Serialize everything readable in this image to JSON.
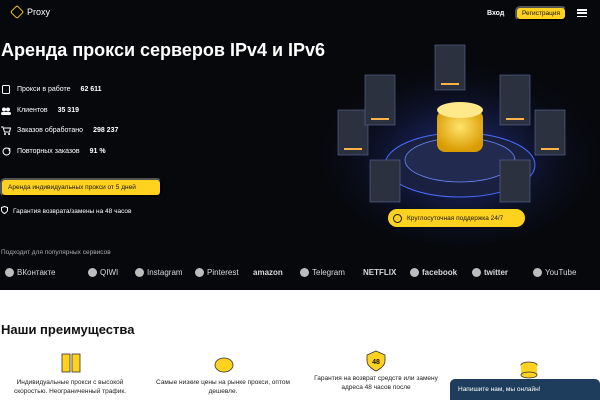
{
  "header": {
    "brand": "Proxy",
    "login": "Вход",
    "register": "Регистрация"
  },
  "hero": {
    "title": "Аренда прокси серверов IPv4 и IPv6",
    "stats": [
      {
        "label": "Прокси в работе",
        "value": "62 611",
        "icon": "server-icon"
      },
      {
        "label": "Клиентов",
        "value": "35 319",
        "icon": "users-icon"
      },
      {
        "label": "Заказов обработано",
        "value": "298 237",
        "icon": "cart-icon"
      },
      {
        "label": "Повторных заказов",
        "value": "91 %",
        "icon": "repeat-icon"
      }
    ],
    "cta": "Аренда индивидуальных прокси от 5 дней",
    "guarantee": "Гарантия возврата/замены на 48 часов",
    "support": "Круглосуточная поддержка 24/7",
    "popular": "Подходит для популярных сервисов"
  },
  "brands": [
    "ВКонтакте",
    "QIWI",
    "Instagram",
    "Pinterest",
    "amazon",
    "Telegram",
    "NETFLIX",
    "facebook",
    "twitter",
    "YouTube"
  ],
  "advantages": {
    "title": "Наши преимущества",
    "items": [
      {
        "text": "Индивидуальные прокси с высокой скоростью. Неограниченный трафик.",
        "icon": "server-rack-icon"
      },
      {
        "text": "Самые низкие цены на рынке прокси, оптом дешевле.",
        "icon": "piggy-bank-icon"
      },
      {
        "text": "Гарантия на возврат средств или замену адреса 48 часов после",
        "icon": "shield-48-icon",
        "badge": "48"
      },
      {
        "text": "",
        "icon": "database-icon"
      }
    ]
  },
  "chat": {
    "label": "Напишите нам, мы онлайн!"
  },
  "colors": {
    "accent": "#ffd21f",
    "hero_bg": "#07080c",
    "chat_bg": "#1e3d5c"
  }
}
